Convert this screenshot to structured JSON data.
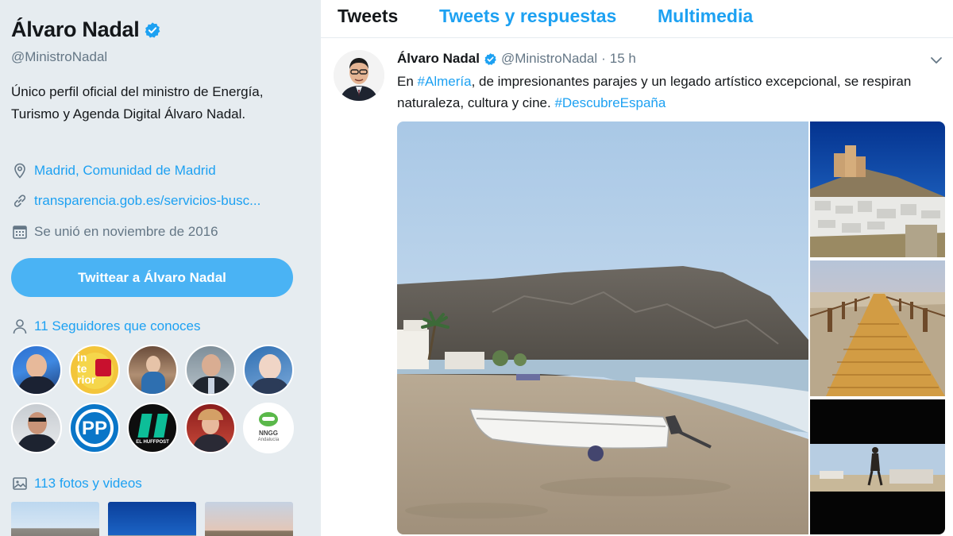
{
  "profile": {
    "name": "Álvaro Nadal",
    "handle": "@MinistroNadal",
    "bio": "Único perfil oficial del ministro de Energía, Turismo y Agenda Digital Álvaro Nadal.",
    "location": "Madrid, Comunidad de Madrid",
    "website": "transparencia.gob.es/servicios-busc...",
    "joined": "Se unió en noviembre de 2016",
    "tweet_to_label": "Twittear a Álvaro Nadal",
    "followers_you_know": "11 Seguidores que conoces",
    "photos_videos": "113 fotos y videos",
    "follower_avatars": [
      {
        "name": "follower-avatar-1"
      },
      {
        "name": "follower-avatar-interior",
        "lines": [
          "in",
          "te",
          "rior"
        ]
      },
      {
        "name": "follower-avatar-3"
      },
      {
        "name": "follower-avatar-4"
      },
      {
        "name": "follower-avatar-5"
      },
      {
        "name": "follower-avatar-6"
      },
      {
        "name": "follower-avatar-pp",
        "text": "PP"
      },
      {
        "name": "follower-avatar-huffpost",
        "text": "EL HUFFPOST"
      },
      {
        "name": "follower-avatar-9"
      },
      {
        "name": "follower-avatar-nnggg",
        "text": "NNGG",
        "subtext": "Andalucía"
      }
    ],
    "icons": {
      "location": "map-pin-icon",
      "website": "link-icon",
      "joined": "calendar-icon",
      "followers": "person-icon",
      "photos": "image-icon",
      "verified": "verified-badge-icon"
    }
  },
  "tabs": [
    {
      "label": "Tweets",
      "active": true
    },
    {
      "label": "Tweets y respuestas",
      "active": false
    },
    {
      "label": "Multimedia",
      "active": false
    }
  ],
  "tweet": {
    "author_name": "Álvaro Nadal",
    "author_handle": "@MinistroNadal",
    "separator": "·",
    "time": "15 h",
    "text_parts": [
      {
        "t": "En ",
        "link": false
      },
      {
        "t": "#Almería",
        "link": true
      },
      {
        "t": ", de impresionantes parajes y un legado artístico excepcional, se respiran naturaleza, cultura y cine. ",
        "link": false
      },
      {
        "t": "#DescubreEspaña",
        "link": true
      }
    ],
    "media": [
      "beach-photo",
      "castle-village-photo",
      "boardwalk-photo",
      "film-scene-photo"
    ]
  },
  "colors": {
    "accent": "#1da1f2",
    "button": "#4ab3f4",
    "background": "#e6ecf0",
    "secondary_text": "#657786"
  }
}
